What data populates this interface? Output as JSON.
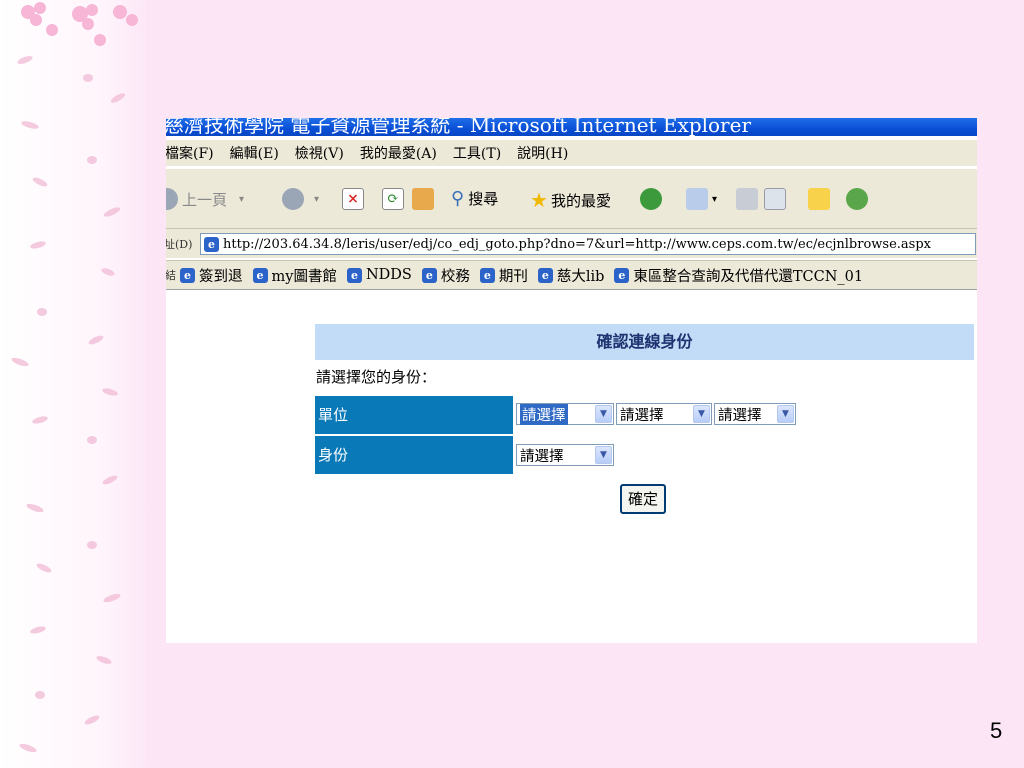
{
  "browser": {
    "title": "慈濟技術學院 電子資源管理系統 - Microsoft Internet Explorer",
    "menu": [
      "檔案(F)",
      "編輯(E)",
      "檢視(V)",
      "我的最愛(A)",
      "工具(T)",
      "說明(H)"
    ],
    "toolbar": {
      "back": "上一頁",
      "search": "搜尋",
      "favorites": "我的最愛"
    },
    "address_label": "址(D)",
    "address_url": "http://203.64.34.8/leris/user/edj/co_edj_goto.php?dno=7&url=http://www.ceps.com.tw/ec/ecjnlbrowse.aspx",
    "links_label": "結",
    "links": [
      "簽到退",
      "my圖書館",
      "NDDS",
      "校務",
      "期刊",
      "慈大lib",
      "東區整合查詢及代借代還TCCN_01"
    ]
  },
  "form": {
    "header": "確認連線身份",
    "prompt": "請選擇您的身份：",
    "unit_label": "單位",
    "unit_selects": [
      "請選擇",
      "請選擇",
      "請選擇"
    ],
    "identity_label": "身份",
    "identity_select": "請選擇",
    "submit": "確定"
  },
  "slide": {
    "page_number": "5"
  },
  "colors": {
    "background": "#fce6f6",
    "titlebar": "#0a4fd6",
    "form_header": "#c2dcf7",
    "row_label": "#0a79b8"
  }
}
